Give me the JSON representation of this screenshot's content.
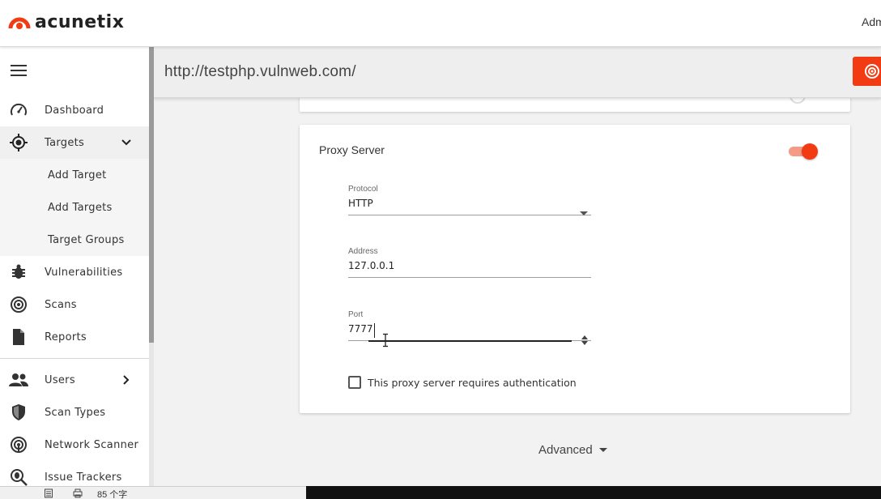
{
  "header": {
    "brand": "acunetix",
    "user_label": "Adm"
  },
  "sidebar": {
    "items": [
      {
        "label": "Dashboard",
        "icon": "gauge-icon"
      },
      {
        "label": "Targets",
        "icon": "target-icon"
      },
      {
        "label": "Vulnerabilities",
        "icon": "bug-icon"
      },
      {
        "label": "Scans",
        "icon": "radar-icon"
      },
      {
        "label": "Reports",
        "icon": "file-icon"
      },
      {
        "label": "Users",
        "icon": "users-icon"
      },
      {
        "label": "Scan Types",
        "icon": "shield-icon"
      },
      {
        "label": "Network Scanner",
        "icon": "network-icon"
      },
      {
        "label": "Issue Trackers",
        "icon": "bug-search-icon"
      }
    ],
    "target_subitems": [
      "Add Target",
      "Add Targets",
      "Target Groups"
    ]
  },
  "urlbar": {
    "url": "http://testphp.vulnweb.com/"
  },
  "proxy": {
    "title": "Proxy Server",
    "enabled": true,
    "protocol_label": "Protocol",
    "protocol_value": "HTTP",
    "address_label": "Address",
    "address_value": "127.0.0.1",
    "port_label": "Port",
    "port_value": "7777",
    "auth_label": "This proxy server requires authentication",
    "auth_checked": false
  },
  "advanced": {
    "label": "Advanced"
  },
  "statusbar": {
    "text": "85 个字"
  },
  "colors": {
    "accent": "#f23b13",
    "accent_light": "#f59a85"
  }
}
